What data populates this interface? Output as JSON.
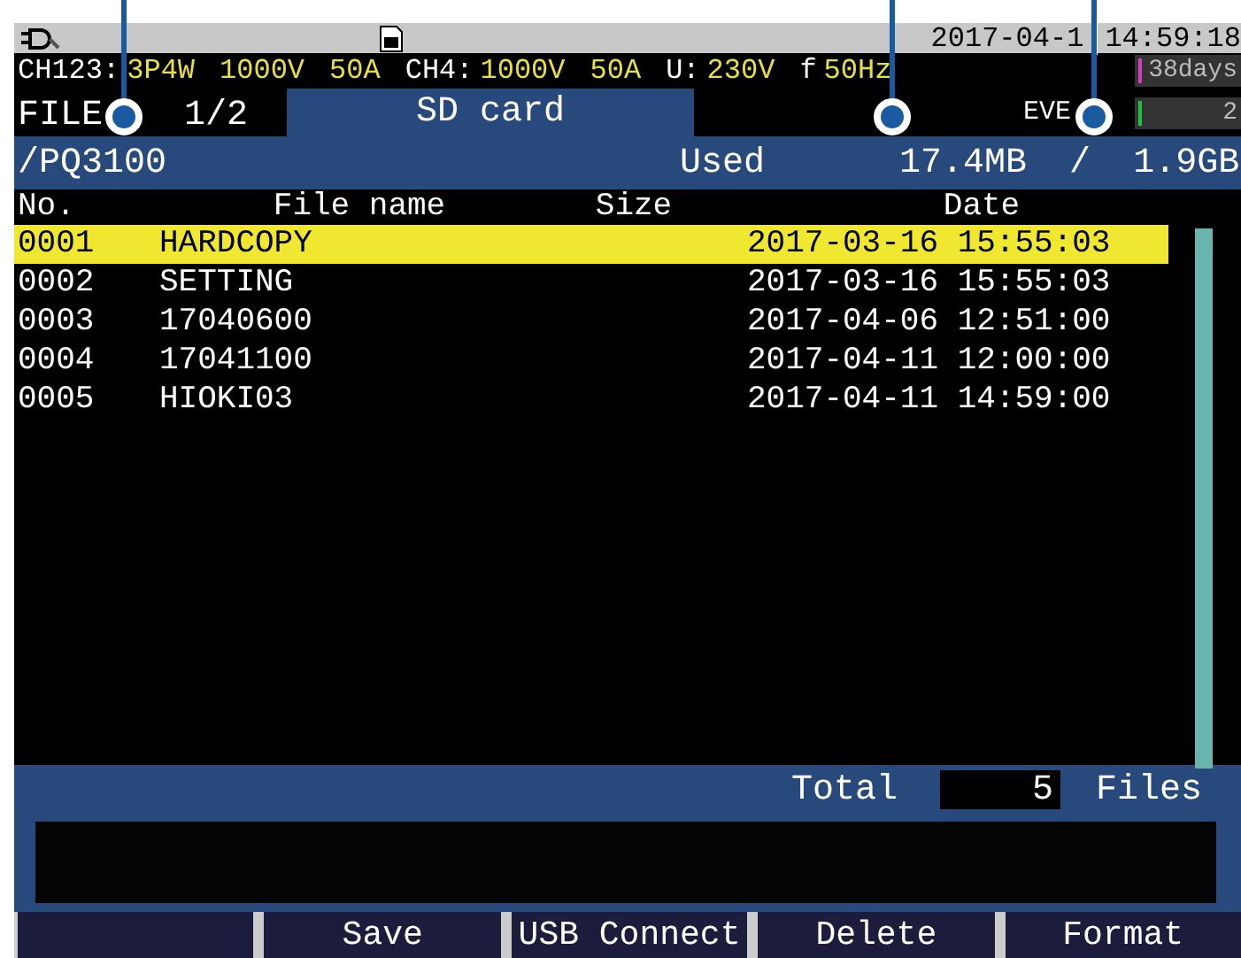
{
  "status_bar": {
    "date": "2017-04-1",
    "time": "14:59:18"
  },
  "info_bar": [
    {
      "text": "CH123:",
      "kind": "label"
    },
    {
      "text": "3P4W",
      "kind": "value"
    },
    {
      "text": "1000V",
      "kind": "value"
    },
    {
      "text": "50A",
      "kind": "value"
    },
    {
      "text": "CH4:",
      "kind": "label"
    },
    {
      "text": "1000V",
      "kind": "value"
    },
    {
      "text": "50A",
      "kind": "value"
    },
    {
      "text": "U:",
      "kind": "label"
    },
    {
      "text": "230V",
      "kind": "value"
    },
    {
      "text": "f",
      "kind": "label"
    },
    {
      "text": "50Hz",
      "kind": "value"
    }
  ],
  "counters": [
    {
      "text": "38days",
      "color": "#d040c0"
    },
    {
      "text": "2",
      "color": "#20c040"
    }
  ],
  "tabs": [
    {
      "label": "FILE",
      "selected": false
    },
    {
      "label": "1/2",
      "selected": false
    },
    {
      "label": "SD card",
      "selected": true
    }
  ],
  "event_label": "EVE",
  "path_bar": {
    "path": "/PQ3100",
    "used_label": "Used",
    "used": "17.4MB",
    "separator": "/",
    "capacity": "1.9GB"
  },
  "table": {
    "columns": [
      "No.",
      "File name",
      "Size",
      "Date"
    ],
    "rows": [
      {
        "no": "0001",
        "name": "HARDCOPY",
        "date": "2017-03-16 15:55:03",
        "selected": true
      },
      {
        "no": "0002",
        "name": "SETTING",
        "date": "2017-03-16 15:55:03",
        "selected": false
      },
      {
        "no": "0003",
        "name": "17040600",
        "date": "2017-04-06 12:51:00",
        "selected": false
      },
      {
        "no": "0004",
        "name": "17041100",
        "date": "2017-04-11 12:00:00",
        "selected": false
      },
      {
        "no": "0005",
        "name": "HIOKI03",
        "date": "2017-04-11 14:59:00",
        "selected": false
      }
    ]
  },
  "total": {
    "label": "Total",
    "count": "5",
    "unit": "Files"
  },
  "function_keys": [
    "Save",
    "USB Connect",
    "Delete",
    "Format"
  ]
}
